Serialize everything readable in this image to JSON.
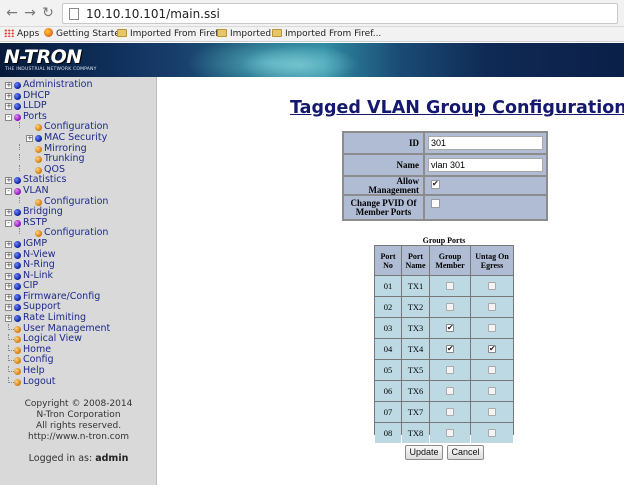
{
  "browser": {
    "url": "10.10.10.101/main.ssi",
    "bookmarks": [
      {
        "label": "Apps",
        "icon": "apps-grid-icon"
      },
      {
        "label": "Getting Started",
        "icon": "firefox-icon"
      },
      {
        "label": "Imported From Firef...",
        "icon": "folder-icon"
      },
      {
        "label": "Imported",
        "icon": "folder-icon"
      },
      {
        "label": "Imported From Firef...",
        "icon": "folder-icon"
      }
    ]
  },
  "banner": {
    "logo": "N-TRON",
    "tagline": "THE INDUSTRIAL NETWORK COMPANY"
  },
  "sidebar": {
    "items": [
      {
        "label": "Administration",
        "bullet": "blue",
        "expander": "+"
      },
      {
        "label": "DHCP",
        "bullet": "blue",
        "expander": "+"
      },
      {
        "label": "LLDP",
        "bullet": "blue",
        "expander": "+"
      },
      {
        "label": "Ports",
        "bullet": "purple",
        "expander": "-"
      },
      {
        "label": "Configuration",
        "bullet": "orange",
        "expander": ""
      },
      {
        "label": "MAC Security",
        "bullet": "blue",
        "expander": "+"
      },
      {
        "label": "Mirroring",
        "bullet": "orange",
        "expander": ""
      },
      {
        "label": "Trunking",
        "bullet": "orange",
        "expander": ""
      },
      {
        "label": "QOS",
        "bullet": "orange",
        "expander": ""
      },
      {
        "label": "Statistics",
        "bullet": "blue",
        "expander": "+"
      },
      {
        "label": "VLAN",
        "bullet": "purple",
        "expander": "-"
      },
      {
        "label": "Configuration",
        "bullet": "orange",
        "expander": ""
      },
      {
        "label": "Bridging",
        "bullet": "blue",
        "expander": "+"
      },
      {
        "label": "RSTP",
        "bullet": "purple",
        "expander": "-"
      },
      {
        "label": "Configuration",
        "bullet": "orange",
        "expander": ""
      },
      {
        "label": "IGMP",
        "bullet": "blue",
        "expander": "+"
      },
      {
        "label": "N-View",
        "bullet": "blue",
        "expander": "+"
      },
      {
        "label": "N-Ring",
        "bullet": "blue",
        "expander": "+"
      },
      {
        "label": "N-Link",
        "bullet": "blue",
        "expander": "+"
      },
      {
        "label": "CIP",
        "bullet": "blue",
        "expander": "+"
      },
      {
        "label": "Firmware/Config",
        "bullet": "blue",
        "expander": "+"
      },
      {
        "label": "Support",
        "bullet": "blue",
        "expander": "+"
      },
      {
        "label": "Rate Limiting",
        "bullet": "blue",
        "expander": "+"
      },
      {
        "label": "User Management",
        "bullet": "orange",
        "expander": ""
      },
      {
        "label": "Logical View",
        "bullet": "orange",
        "expander": ""
      },
      {
        "label": "Home",
        "bullet": "orange",
        "expander": ""
      },
      {
        "label": "Config",
        "bullet": "orange",
        "expander": ""
      },
      {
        "label": "Help",
        "bullet": "orange",
        "expander": ""
      },
      {
        "label": "Logout",
        "bullet": "orange",
        "expander": ""
      }
    ],
    "copyright": [
      "Copyright © 2008-2014",
      "N-Tron Corporation",
      "All rights reserved.",
      "http://www.n-tron.com"
    ],
    "logged_in_label": "Logged in as:",
    "logged_in_user": "admin"
  },
  "main": {
    "title": "Tagged VLAN Group Configuration",
    "form": {
      "id_label": "ID",
      "id_value": "301",
      "name_label": "Name",
      "name_value": "vlan 301",
      "allow_management_label": "Allow Management",
      "allow_management_checked": true,
      "change_pvid_label": "Change PVID Of Member Ports",
      "change_pvid_checked": false
    },
    "group_ports": {
      "caption": "Group Ports",
      "headers": [
        "Port No",
        "Port Name",
        "Group Member",
        "Untag On Egress"
      ],
      "rows": [
        {
          "no": "01",
          "name": "TX1",
          "member": false,
          "untag": false
        },
        {
          "no": "02",
          "name": "TX2",
          "member": false,
          "untag": false
        },
        {
          "no": "03",
          "name": "TX3",
          "member": true,
          "untag": false
        },
        {
          "no": "04",
          "name": "TX4",
          "member": true,
          "untag": true
        },
        {
          "no": "05",
          "name": "TX5",
          "member": false,
          "untag": false
        },
        {
          "no": "06",
          "name": "TX6",
          "member": false,
          "untag": false
        },
        {
          "no": "07",
          "name": "TX7",
          "member": false,
          "untag": false
        },
        {
          "no": "08",
          "name": "TX8",
          "member": false,
          "untag": false
        }
      ]
    },
    "buttons": {
      "update": "Update",
      "cancel": "Cancel"
    }
  },
  "colors": {
    "title": "#14186e",
    "label_cell": "#b0bcd3",
    "port_cell": "#bcd9e4",
    "sidebar_bg": "#d9d9d9",
    "nav_text": "#1e2a8a"
  }
}
